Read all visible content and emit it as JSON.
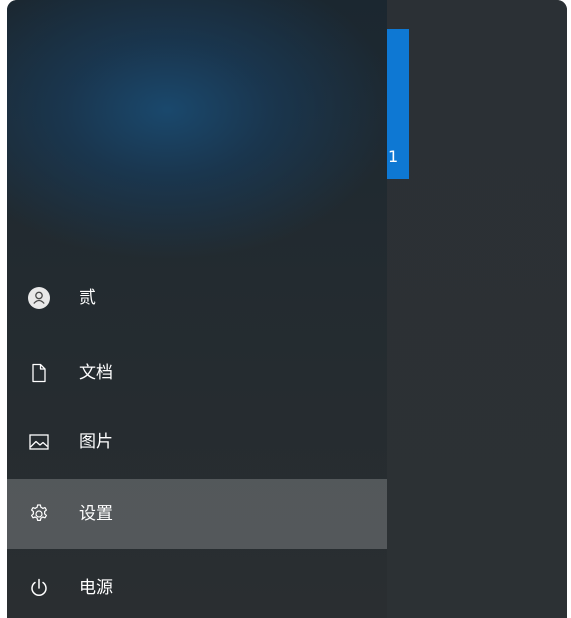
{
  "tile": {
    "char": "1",
    "color": "#0e78d3"
  },
  "menu": {
    "items": [
      {
        "id": "user",
        "label": "贰",
        "icon": "user-avatar-icon"
      },
      {
        "id": "documents",
        "label": "文档",
        "icon": "document-icon"
      },
      {
        "id": "pictures",
        "label": "图片",
        "icon": "picture-icon"
      },
      {
        "id": "settings",
        "label": "设置",
        "icon": "gear-icon",
        "highlighted": true
      },
      {
        "id": "power",
        "label": "电源",
        "icon": "power-icon"
      }
    ]
  }
}
